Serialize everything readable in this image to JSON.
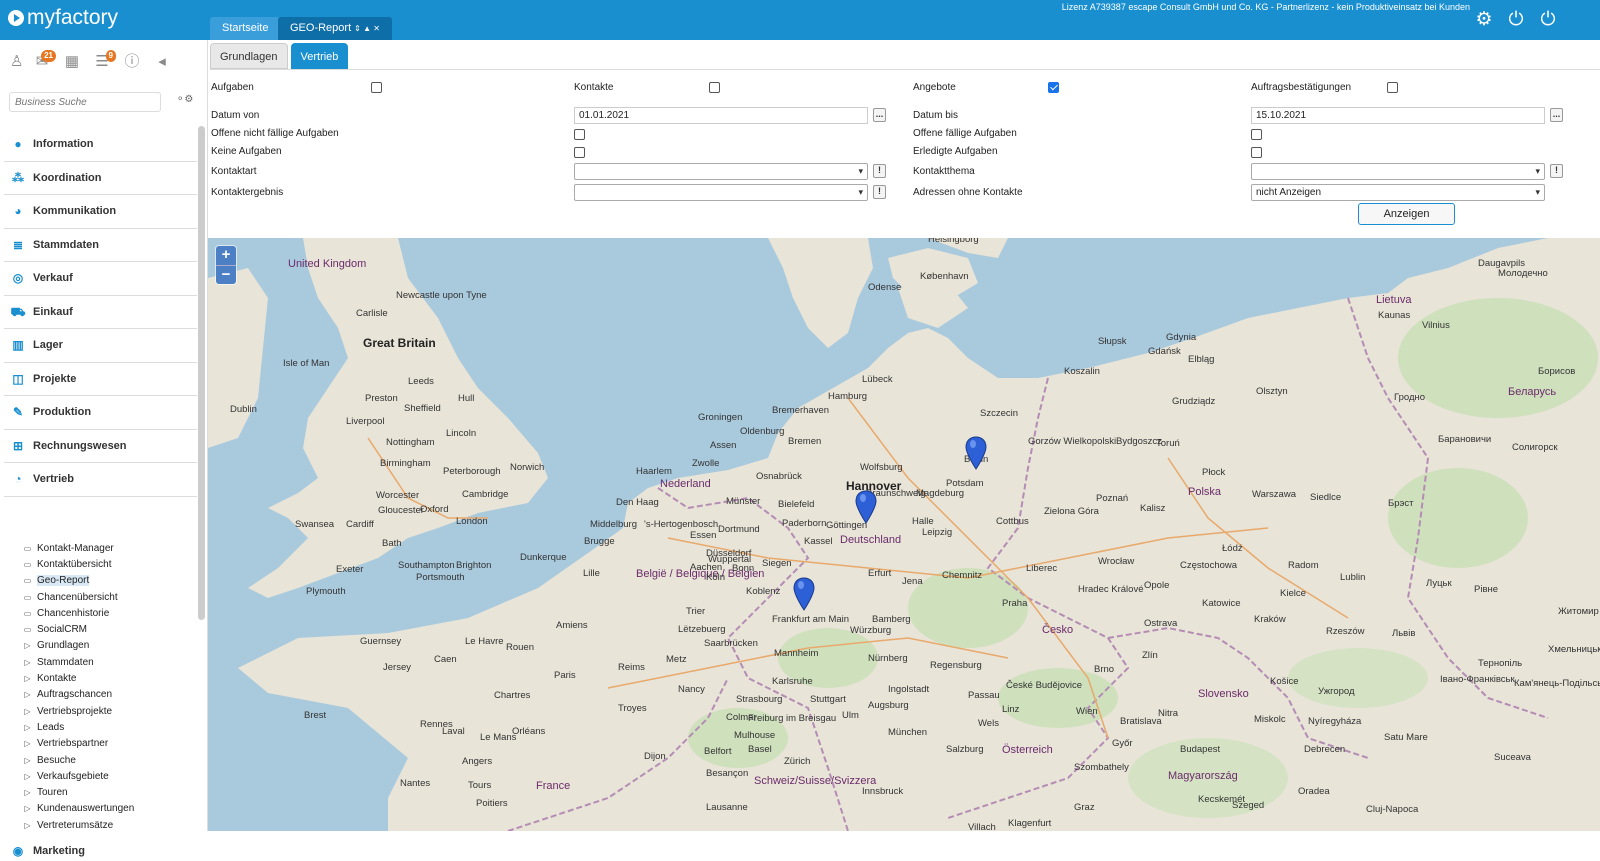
{
  "app": {
    "name": "myfactory",
    "license": "Lizenz A739387 escape Consult GmbH und Co. KG - Partnerlizenz - kein Produktiveinsatz bei Kunden"
  },
  "tabs": [
    {
      "label": "Startseite"
    },
    {
      "label": "GEO-Report",
      "controls": "⇕ ▲ ✕"
    }
  ],
  "toolbar": {
    "badge1": "21",
    "badge2": "9"
  },
  "search": {
    "placeholder": "Business Suche"
  },
  "nav": {
    "items": [
      "Information",
      "Koordination",
      "Kommunikation",
      "Stammdaten",
      "Verkauf",
      "Einkauf",
      "Lager",
      "Projekte",
      "Produktion",
      "Rechnungswesen",
      "Vertrieb"
    ],
    "sub": [
      "Kontakt-Manager",
      "Kontaktübersicht",
      "Geo-Report",
      "Chancenübersicht",
      "Chancenhistorie",
      "SocialCRM",
      "Grundlagen",
      "Stammdaten",
      "Kontakte",
      "Auftragschancen",
      "Vertriebsprojekte",
      "Leads",
      "Vertriebspartner",
      "Besuche",
      "Verkaufsgebiete",
      "Touren",
      "Kundenauswertungen",
      "Vertreterumsätze"
    ],
    "marketing": "Marketing"
  },
  "subtabs": [
    "Grundlagen",
    "Vertrieb"
  ],
  "form": {
    "aufgaben": "Aufgaben",
    "kontakte": "Kontakte",
    "angebote": "Angebote",
    "auftragsbest": "Auftragsbestätigungen",
    "datum_von_label": "Datum von",
    "datum_von": "01.01.2021",
    "datum_bis_label": "Datum bis",
    "datum_bis": "15.10.2021",
    "offene_nicht": "Offene nicht fällige Aufgaben",
    "offene_faellige": "Offene fällige Aufgaben",
    "keine": "Keine Aufgaben",
    "erledigte": "Erledigte Aufgaben",
    "kontaktart": "Kontaktart",
    "kontaktthema": "Kontaktthema",
    "kontaktergebnis": "Kontaktergebnis",
    "adressen_ohne": "Adressen ohne Kontakte",
    "adressen_ohne_value": "nicht Anzeigen",
    "ellipsis": "...",
    "bang": "!",
    "show_button": "Anzeigen"
  },
  "map": {
    "zoom_in": "+",
    "zoom_out": "−",
    "labels": {
      "uk": "United Kingdom",
      "gb": "Great Britain",
      "newcastle": "Newcastle upon Tyne",
      "carlisle": "Carlisle",
      "isle": "Isle of Man",
      "dublin": "Dublin",
      "leeds": "Leeds",
      "liverpool": "Liverpool",
      "sheffield": "Sheffield",
      "preston": "Preston",
      "hull": "Hull",
      "lincoln": "Lincoln",
      "nottingham": "Nottingham",
      "birmingham": "Birmingham",
      "peterborough": "Peterborough",
      "norwich": "Norwich",
      "worcester": "Worcester",
      "cambridge": "Cambridge",
      "gloucester": "Gloucester",
      "oxford": "Oxford",
      "cardiff": "Cardiff",
      "swansea": "Swansea",
      "london": "London",
      "bath": "Bath",
      "exeter": "Exeter",
      "southampton": "Southampton",
      "brighton": "Brighton",
      "plymouth": "Plymouth",
      "portsmouth": "Portsmouth",
      "guernsey": "Guernsey",
      "jersey": "Jersey",
      "helsingborg": "Helsingborg",
      "kobenhavn": "København",
      "odense": "Odense",
      "hamburg": "Hamburg",
      "lubeck": "Lübeck",
      "bremen": "Bremen",
      "bremerhaven": "Bremerhaven",
      "groningen": "Groningen",
      "oldenburg": "Oldenburg",
      "assen": "Assen",
      "zwolle": "Zwolle",
      "nederland": "Nederland",
      "haarlem": "Haarlem",
      "denhaag": "Den Haag",
      "osnabruck": "Osnabrück",
      "hannover": "Hannover",
      "wolfsburg": "Wolfsburg",
      "berlin": "Berlin",
      "potsdam": "Potsdam",
      "munster": "Münster",
      "bielefeld": "Bielefeld",
      "deutschland": "Deutschland",
      "kassel": "Kassel",
      "leipzig": "Leipzig",
      "dusseldorf": "Düsseldorf",
      "bonn": "Bonn",
      "aachen": "Aachen",
      "koblenz": "Koblenz",
      "frankfurt": "Frankfurt am Main",
      "chemnitz": "Chemnitz",
      "cottbus": "Cottbus",
      "belgie": "België / Belgique / Belgien",
      "brugge": "Brugge",
      "middelburg": "Middelburg",
      "hertogenbosch": "'s-Hertogenbosch",
      "dunkerque": "Dunkerque",
      "lille": "Lille",
      "letzebuerg": "Lëtzebuerg",
      "wurzburg": "Würzburg",
      "nurnberg": "Nürnberg",
      "praha": "Praha",
      "cesko": "Česko",
      "mannheim": "Mannheim",
      "karlsruhe": "Karlsruhe",
      "stuttgart": "Stuttgart",
      "ingolstadt": "Ingolstadt",
      "augsburg": "Augsburg",
      "munchen": "München",
      "ulm": "Ulm",
      "freiburg": "Freiburg im Breisgau",
      "basel": "Basel",
      "zurich": "Zürich",
      "schweiz": "Schweiz/Suisse/Svizzera",
      "paris": "Paris",
      "reims": "Reims",
      "rouen": "Rouen",
      "lehavre": "Le Havre",
      "caen": "Caen",
      "rennes": "Rennes",
      "brest": "Brest",
      "lemans": "Le Mans",
      "angers": "Angers",
      "troyes": "Troyes",
      "france": "France",
      "poitiers": "Poitiers",
      "dijon": "Dijon",
      "besancon": "Besançon",
      "belfort": "Belfort",
      "lausanne": "Lausanne",
      "salzburg": "Salzburg",
      "osterreich": "Österreich",
      "wien": "Wien",
      "linz": "Linz",
      "bratislava": "Bratislava",
      "brno": "Brno",
      "budapest": "Budapest",
      "magyarorszag": "Magyarország",
      "slovensko": "Slovensko",
      "ostrava": "Ostrava",
      "katowice": "Katowice",
      "krakow": "Kraków",
      "polska": "Polska",
      "warszawa": "Warszawa",
      "lodz": "Łódź",
      "poznan": "Poznań",
      "bydgoszcz": "Bydgoszcz",
      "gdansk": "Gdańsk",
      "gdynia": "Gdynia",
      "szczecin": "Szczecin",
      "koszalin": "Koszalin",
      "slupsk": "Słupsk",
      "elblag": "Elbląg",
      "grudziadz": "Grudziądz",
      "olsztyn": "Olsztyn",
      "torun": "Toruń",
      "gorzow": "Gorzów Wielkopolski",
      "zielona": "Zielona Góra",
      "wroclaw": "Wrocław",
      "opole": "Opole",
      "kalisz": "Kalisz",
      "lublin": "Lublin",
      "radom": "Radom",
      "kielce": "Kielce",
      "rzeszow": "Rzeszów",
      "siedlce": "Siedlce",
      "plock": "Płock",
      "czestochowa": "Częstochowa",
      "liberec": "Liberec",
      "hradec": "Hradec Králové",
      "zlin": "Zlín",
      "budejovice": "České Budějovice",
      "lietuva": "Lietuva",
      "kaunas": "Kaunas",
      "vilnius": "Vilnius",
      "grodno": "Гродно",
      "brest_by": "Брэст",
      "belarus": "Беларусь",
      "lutsk": "Луцьк",
      "rivne": "Рівне",
      "lviv": "Львів",
      "zhytomyr": "Житомир",
      "uzhhorod": "Ужгород",
      "kosice": "Košice",
      "miskolc": "Miskolc",
      "debrecen": "Debrecen",
      "oradea": "Oradea",
      "cluj": "Cluj-Napoca",
      "szeged": "Szeged",
      "kecskemet": "Kecskemét",
      "gyor": "Győr",
      "szombathely": "Szombathely",
      "nitra": "Nitra",
      "satu": "Satu Mare",
      "nyiregyhaza": "Nyíregyháza",
      "suceava": "Suceava",
      "daugavpils": "Daugavpils",
      "molodechno": "Молодечно",
      "borisov": "Борисов",
      "baranovichi": "Барановичи",
      "soligorsk": "Солигорск",
      "ternopil": "Тернопіль",
      "khmelnytskyi": "Хмельницький",
      "kamyanets": "Кам'янець-Подільський",
      "ivano": "Івано-Франківськ",
      "graz": "Graz",
      "klagenfurt": "Klagenfurt",
      "villach": "Villach",
      "innsbruck": "Innsbruck",
      "wels": "Wels",
      "regensburg": "Regensburg",
      "passau": "Passau",
      "bamberg": "Bamberg",
      "erfurt": "Erfurt",
      "jena": "Jena",
      "magdeburg": "Magdeburg",
      "halle": "Halle",
      "braunschweig": "Braunschweig",
      "gottingen": "Göttingen",
      "paderborn": "Paderborn",
      "dortmund": "Dortmund",
      "essen": "Essen",
      "koln": "Köln",
      "wuppertal": "Wuppertal",
      "siegen": "Siegen",
      "trier": "Trier",
      "saarbrucken": "Saarbrücken",
      "metz": "Metz",
      "nancy": "Nancy",
      "strasbourg": "Strasbourg",
      "mulhouse": "Mulhouse",
      "colmar": "Colmar",
      "amiens": "Amiens",
      "chartres": "Chartres",
      "orleans": "Orléans",
      "tours": "Tours",
      "nantes": "Nantes",
      "laval": "Laval"
    }
  }
}
